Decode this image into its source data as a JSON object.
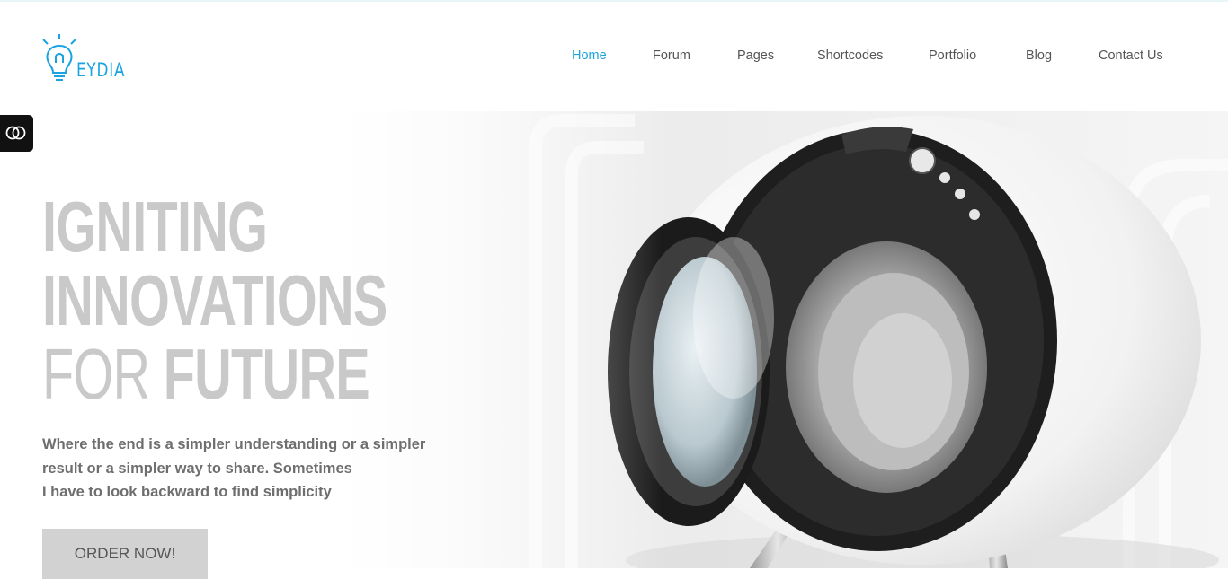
{
  "brand": {
    "logo_text": "EYDIA",
    "accent_color": "#1aa3e0"
  },
  "nav": {
    "items": [
      {
        "label": "Home",
        "active": true
      },
      {
        "label": "Forum",
        "active": false
      },
      {
        "label": "Pages",
        "active": false
      },
      {
        "label": "Shortcodes",
        "active": false
      },
      {
        "label": "Portfolio",
        "active": false
      },
      {
        "label": "Blog",
        "active": false
      },
      {
        "label": "Contact Us",
        "active": false
      }
    ]
  },
  "hero": {
    "headline_line1": "IGNITING",
    "headline_line2": "INNOVATIONS",
    "headline_line3_light": "FOR",
    "headline_line3_bold": "FUTURE",
    "lead_line1": "Where the end is a simpler understanding or a simpler",
    "lead_line2": "result or a simpler way to share. Sometimes",
    "lead_line3": "I have to look backward to find simplicity",
    "cta_label": "ORDER NOW!",
    "image": "washing-machine-with-open-door"
  },
  "side_toggle": {
    "icon": "toggle-icon"
  }
}
